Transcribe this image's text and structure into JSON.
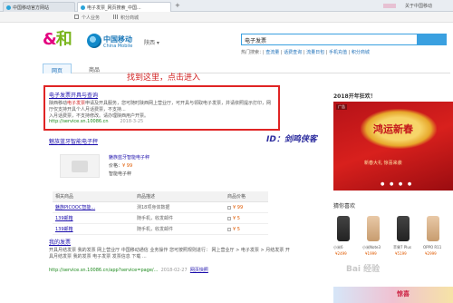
{
  "browser": {
    "tabs": [
      {
        "label": "中国移动官方网站"
      },
      {
        "label": "电子发票_网页搜索_中国..."
      }
    ],
    "new_tab": "+",
    "about_link": "关于中国移动"
  },
  "subnav": {
    "home": "个人业务",
    "grid": "积分商城"
  },
  "header": {
    "brand_and": "和",
    "cm_name": "中国移动",
    "cm_en": "China Mobile",
    "region": "陕西 ▾",
    "search_value": "电子发票",
    "hot_label": "热门搜索：",
    "hot_items": [
      "|",
      "查流量",
      "|",
      "话费查询",
      "|",
      "流量日包",
      "|",
      "手机充值",
      "|",
      "积分商城"
    ]
  },
  "result_tabs": [
    "网页",
    "商品"
  ],
  "annotation": "找到这里，点击进入",
  "watermark": "ID：剑鸣侠客",
  "results": [
    {
      "title": "电子发票开具与查询",
      "desc_prefix": "陕西移动",
      "keyword": "电子发票",
      "desc_rest": "申请及开具服务，您可随时陕西网上营业厅，可开具与领取电子发票，并请依照提示打印，网厅仅支持开具个人月话费票，不支持...",
      "desc_line2": "入月话费票，不支持修改。请办理陕西用户开票。",
      "url": "http://service.sn.10086.cn",
      "date": "2018-3-25"
    },
    {
      "title": "魅族蓝牙智能电子秤"
    },
    {
      "title": "我的发票",
      "desc": "开具月结发票 我的发票 网上营业厅 中国移动通信 业务操作 您可按照规则进行： 网上营业厅 > 电子发票 > 月结发票 开具月结发票 我的发票 电子发票 发票信息 下载 ...",
      "url": "http://service.sn.10086.cn/app?service=page/...",
      "date": "2018-02-27",
      "snapshot": "网页快照"
    }
  ],
  "product": {
    "name": "魅族蓝牙智能电子秤",
    "price_label": "价格：",
    "price": "¥ 99",
    "category": "智能电子秤",
    "table_headers": [
      "相关商品",
      "商品描述",
      "商品价格"
    ],
    "table_rows": [
      {
        "name": "魅族PICOOC智能...",
        "desc": "测18项身体数据",
        "price": "¥ 99"
      },
      {
        "name": "139邮箱",
        "desc": "随手机，收发邮件",
        "price": "¥ 5"
      },
      {
        "name": "139邮箱",
        "desc": "随手机，收发邮件",
        "price": "¥ 5"
      }
    ]
  },
  "sidebar": {
    "title": "2018开年狂欢！",
    "banner_ad": "广告",
    "banner_text": "鸿运新春",
    "banner_sub": "新春大礼 惊喜来袭",
    "banner_dots": "● ● ● ●",
    "recommend_title": "猜你喜欢",
    "phones": [
      {
        "name": "小米6",
        "price": "¥2499"
      },
      {
        "name": "小米Note3",
        "price": "¥1999"
      },
      {
        "name": "苹果7 Plus",
        "price": "¥5199"
      },
      {
        "name": "OPPO R11",
        "price": "¥2999"
      }
    ]
  },
  "overlay": {
    "baidu_watermark": "Bai 经验",
    "bottom_strip_text": "惊喜"
  }
}
